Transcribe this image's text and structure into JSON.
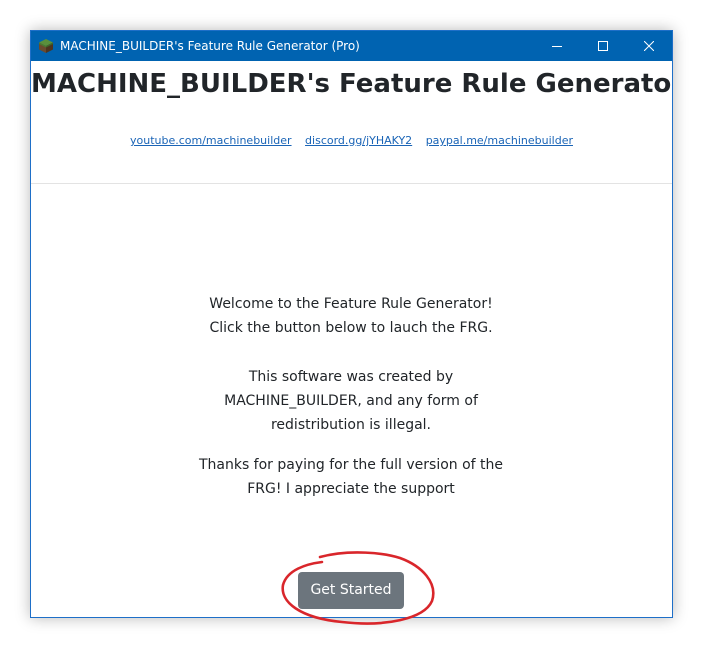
{
  "window": {
    "title": "MACHINE_BUILDER's Feature Rule Generator (Pro)",
    "icon": "minecraft-block-icon"
  },
  "header": {
    "title": "MACHINE_BUILDER's Feature Rule Generator",
    "links": [
      "youtube.com/machinebuilder",
      "discord.gg/jYHAKY2",
      "paypal.me/machinebuilder"
    ]
  },
  "message": {
    "welcome_line1": "Welcome to the Feature Rule Generator!",
    "welcome_line2": "Click the button below to lauch the FRG.",
    "created": "This software was created by MACHINE_BUILDER, and any form of redistribution is illegal.",
    "thanks": "Thanks for paying for the full version of the FRG! I appreciate the support"
  },
  "actions": {
    "get_started_label": "Get Started"
  },
  "colors": {
    "titlebar": "#0063b1",
    "link": "#1a64b6",
    "button": "#6c757d",
    "annotation": "#d9262b"
  }
}
